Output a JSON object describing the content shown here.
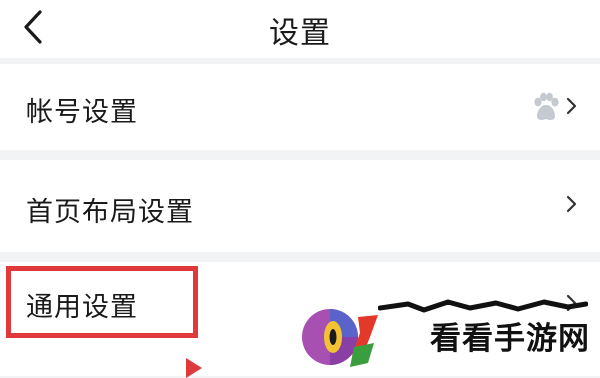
{
  "header": {
    "title": "设置",
    "back_icon": "chevron-left-icon"
  },
  "settings": {
    "items": [
      {
        "label": "帐号设置",
        "trailing_icon": "paw-avatar-icon"
      },
      {
        "label": "首页布局设置"
      },
      {
        "label": "通用设置",
        "highlighted": true
      }
    ]
  },
  "watermark": {
    "text": "看看手游网"
  },
  "colors": {
    "highlight": "#e0393b",
    "background": "#f2f3f5",
    "row": "#ffffff",
    "chevron": "#333333"
  }
}
